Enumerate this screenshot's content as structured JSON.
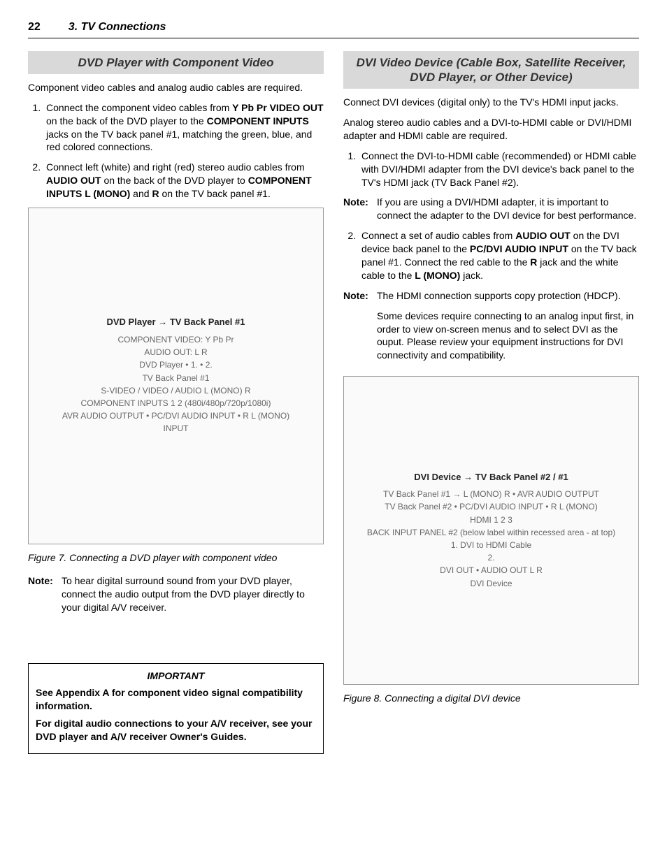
{
  "page_number": "22",
  "chapter_title": "3. TV Connections",
  "left": {
    "heading": "DVD Player with Component Video",
    "intro": "Component video cables and analog audio cables are required.",
    "step1_a": "Connect the component video cables from ",
    "step1_b": "Y Pb Pr VIDEO OUT",
    "step1_c": " on the back of the DVD player to the ",
    "step1_d": "COMPONENT INPUTS",
    "step1_e": " jacks on the TV back panel #1, matching the green, blue, and red colored connections.",
    "step2_a": "Connect left (white) and right (red) stereo audio cables from ",
    "step2_b": "AUDIO OUT",
    "step2_c": " on the back of the DVD player to ",
    "step2_d": "COMPONENT INPUTS  L (MONO)",
    "step2_e": " and ",
    "step2_f": "R",
    "step2_g": " on the TV back panel #1.",
    "diagram_title": "DVD Player → TV Back Panel #1",
    "diagram_labels": [
      "COMPONENT VIDEO: Y Pb Pr",
      "AUDIO OUT: L R",
      "DVD Player • 1. • 2.",
      "TV Back Panel #1",
      "S-VIDEO / VIDEO / AUDIO L (MONO) R",
      "COMPONENT INPUTS 1 2 (480i/480p/720p/1080i)",
      "AVR AUDIO OUTPUT • PC/DVI AUDIO INPUT • R L (MONO)",
      "INPUT"
    ],
    "figure_caption": "Figure 7.  Connecting a DVD player with component video",
    "note_label": "Note:",
    "note_body": "To hear digital surround sound from your DVD player, connect the audio output from the DVD player directly to your digital A/V receiver.",
    "important_title": "IMPORTANT",
    "important_p1": "See Appendix A for component video signal compatibility information.",
    "important_p2": "For digital audio connections to your A/V receiver, see your DVD player and A/V receiver Owner's Guides."
  },
  "right": {
    "heading": "DVI Video Device (Cable Box, Satellite Receiver, DVD Player, or Other Device)",
    "p1": "Connect DVI devices (digital only) to the TV's HDMI input jacks.",
    "p2": "Analog stereo audio cables and a DVI-to-HDMI cable or DVI/HDMI adapter and HDMI cable are required.",
    "step1": "Connect the DVI-to-HDMI cable (recommended) or HDMI cable with DVI/HDMI adapter from the DVI device's back panel to the TV's HDMI jack (TV Back Panel #2).",
    "note1_label": "Note:",
    "note1_body": "If you are using a DVI/HDMI adapter, it is important to connect the adapter to the DVI device for best performance.",
    "step2_a": "Connect a set of audio cables from ",
    "step2_b": "AUDIO OUT",
    "step2_c": " on the DVI device back panel to the ",
    "step2_d": "PC/DVI AUDIO INPUT",
    "step2_e": " on the TV back panel #1.  Connect the red cable to the ",
    "step2_f": "R",
    "step2_g": " jack and the white cable to the ",
    "step2_h": "L (MONO)",
    "step2_i": " jack.",
    "note2_label": "Note:",
    "note2_body1": "The HDMI connection supports copy protection (HDCP).",
    "note2_body2": "Some devices require connecting to an analog input first, in order to view on-screen menus and to select DVI as the ouput.  Please review your equipment instructions for DVI connectivity and compatibility.",
    "diagram_title": "DVI Device → TV Back Panel #2 / #1",
    "diagram_labels": [
      "TV Back Panel #1 → L (MONO) R • AVR AUDIO OUTPUT",
      "TV Back Panel #2 • PC/DVI AUDIO INPUT • R L (MONO)",
      "HDMI 1 2 3",
      "BACK INPUT PANEL #2 (below label within recessed area - at top)",
      "1. DVI to HDMI Cable",
      "2.",
      "DVI OUT • AUDIO OUT L R",
      "DVI Device"
    ],
    "figure_caption": "Figure 8.  Connecting a digital DVI device"
  }
}
